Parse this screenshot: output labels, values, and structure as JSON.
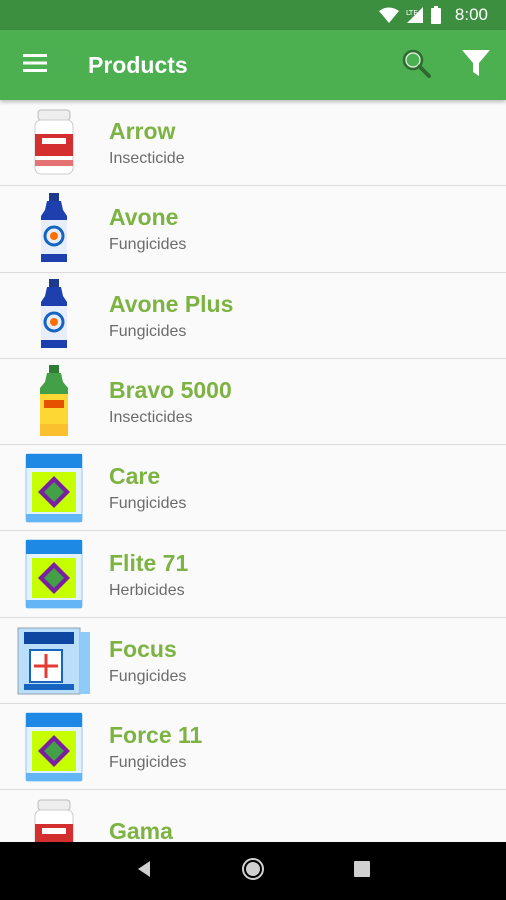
{
  "status_bar": {
    "time": "8:00",
    "network_label": "LTE",
    "icons": [
      "wifi-icon",
      "cell-signal-icon",
      "battery-icon"
    ]
  },
  "app_bar": {
    "title": "Products",
    "icons": [
      "menu-icon",
      "search-icon",
      "filter-icon"
    ]
  },
  "products": [
    {
      "name": "Arrow",
      "category": "Insecticide",
      "thumb": "jar"
    },
    {
      "name": "Avone",
      "category": "Fungicides",
      "thumb": "bottle-blue"
    },
    {
      "name": "Avone Plus",
      "category": "Fungicides",
      "thumb": "bottle-blue"
    },
    {
      "name": "Bravo 5000",
      "category": "Insecticides",
      "thumb": "bottle-green"
    },
    {
      "name": "Care",
      "category": "Fungicides",
      "thumb": "packet"
    },
    {
      "name": "Flite 71",
      "category": "Herbicides",
      "thumb": "packet"
    },
    {
      "name": "Focus",
      "category": "Fungicides",
      "thumb": "box"
    },
    {
      "name": "Force 11",
      "category": "Fungicides",
      "thumb": "packet"
    },
    {
      "name": "Gama",
      "category": "",
      "thumb": "jar"
    }
  ],
  "colors": {
    "primary": "#4caf50",
    "primary_dark": "#3c8f3e",
    "product_name": "#7cb342",
    "category_text": "#6b6b6b"
  }
}
